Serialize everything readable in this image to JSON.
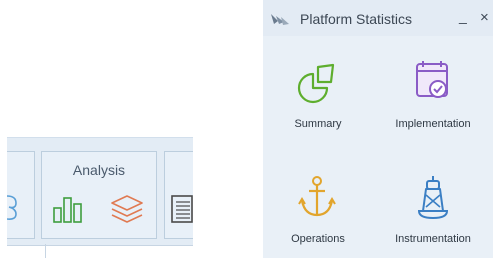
{
  "ribbon": {
    "analysis_group_title": "Analysis",
    "icons": [
      "bar-chart-icon",
      "layers-icon",
      "document-icon",
      "link-icon"
    ],
    "colors": {
      "accent_green": "#3e9e3e",
      "accent_orange": "#e07a52"
    }
  },
  "panel": {
    "title": "Platform Statistics",
    "minimize": "_",
    "close": "×",
    "tiles": [
      {
        "label": "Summary",
        "icon": "pie-chart-icon"
      },
      {
        "label": "Implementation",
        "icon": "calendar-check-icon"
      },
      {
        "label": "Operations",
        "icon": "anchor-icon"
      },
      {
        "label": "Instrumentation",
        "icon": "buoy-icon"
      }
    ],
    "colors": {
      "green": "#5eae2e",
      "purple": "#8a5cc6",
      "orange": "#e2a52d",
      "blue": "#3b7fc4"
    }
  }
}
